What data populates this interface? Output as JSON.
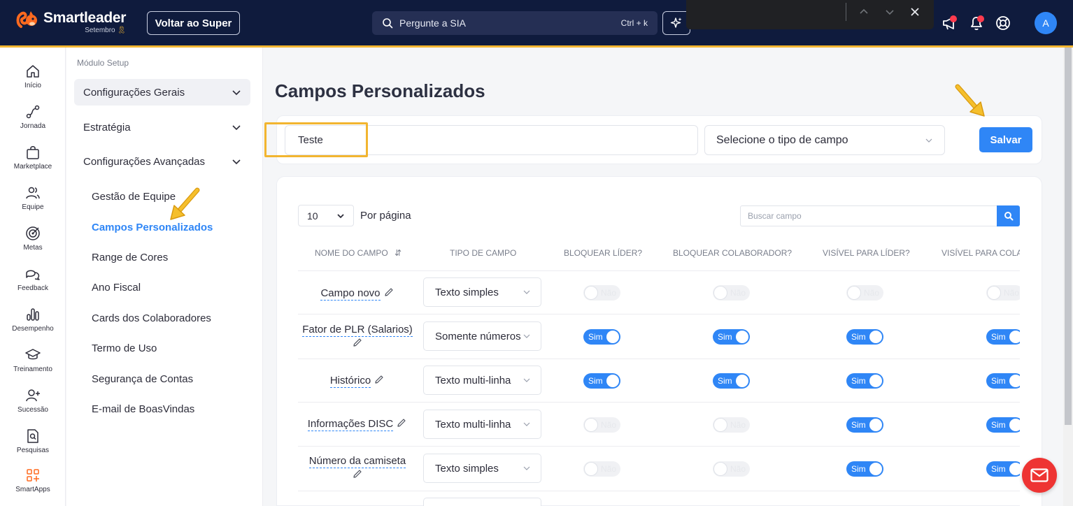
{
  "header": {
    "logo_name": "Smartleader",
    "logo_sub": "Setembro",
    "super_button": "Voltar ao Super",
    "search_placeholder": "Pergunte a SIA",
    "search_shortcut": "Ctrl + k",
    "avatar_letter": "A"
  },
  "rail": [
    {
      "label": "Início",
      "icon": "home-icon"
    },
    {
      "label": "Jornada",
      "icon": "route-icon"
    },
    {
      "label": "Marketplace",
      "icon": "shopping-bag-icon"
    },
    {
      "label": "Equipe",
      "icon": "team-icon"
    },
    {
      "label": "Metas",
      "icon": "target-icon"
    },
    {
      "label": "Feedback",
      "icon": "chat-bubbles-icon"
    },
    {
      "label": "Desempenho",
      "icon": "bar-chart-icon"
    },
    {
      "label": "Treinamento",
      "icon": "graduation-cap-icon"
    },
    {
      "label": "Sucessão",
      "icon": "user-plus-icon"
    },
    {
      "label": "Pesquisas",
      "icon": "search-document-icon"
    },
    {
      "label": "SmartApps",
      "icon": "apps-grid-icon"
    }
  ],
  "setup": {
    "title": "Módulo Setup",
    "groups": [
      "Configurações Gerais",
      "Estratégia",
      "Configurações Avançadas"
    ],
    "items": [
      "Gestão de Equipe",
      "Campos Personalizados",
      "Range de Cores",
      "Ano Fiscal",
      "Cards dos Colaboradores",
      "Termo de Uso",
      "Segurança de Contas",
      "E-mail de BoasVindas"
    ],
    "active_item": "Campos Personalizados"
  },
  "main": {
    "title": "Campos Personalizados",
    "form": {
      "name_value": "Teste",
      "type_placeholder": "Selecione o tipo de campo",
      "save_label": "Salvar"
    },
    "table": {
      "per_page_value": "10",
      "per_page_label": "Por página",
      "search_placeholder": "Buscar campo",
      "columns": [
        "NOME DO CAMPO",
        "TIPO DE CAMPO",
        "BLOQUEAR LÍDER?",
        "BLOQUEAR COLABORADOR?",
        "VISÍVEL PARA LÍDER?",
        "VISÍVEL PARA COLA"
      ],
      "toggle_on": "Sim",
      "toggle_off": "Não",
      "rows": [
        {
          "name": "Campo novo",
          "type": "Texto simples",
          "toggles": [
            false,
            false,
            false,
            false
          ]
        },
        {
          "name": "Fator de PLR (Salarios)",
          "type": "Somente números",
          "toggles": [
            true,
            true,
            true,
            true
          ]
        },
        {
          "name": "Histórico",
          "type": "Texto multi-linha",
          "toggles": [
            true,
            true,
            true,
            true
          ]
        },
        {
          "name": "Informações DISC",
          "type": "Texto multi-linha",
          "toggles": [
            false,
            false,
            true,
            true
          ]
        },
        {
          "name": "Número da camiseta",
          "type": "Texto simples",
          "toggles": [
            false,
            false,
            true,
            true
          ]
        }
      ]
    }
  },
  "colors": {
    "header_bg": "#0f1b3d",
    "accent": "#f2b530",
    "primary": "#2f86f6",
    "chat": "#ee3433"
  }
}
